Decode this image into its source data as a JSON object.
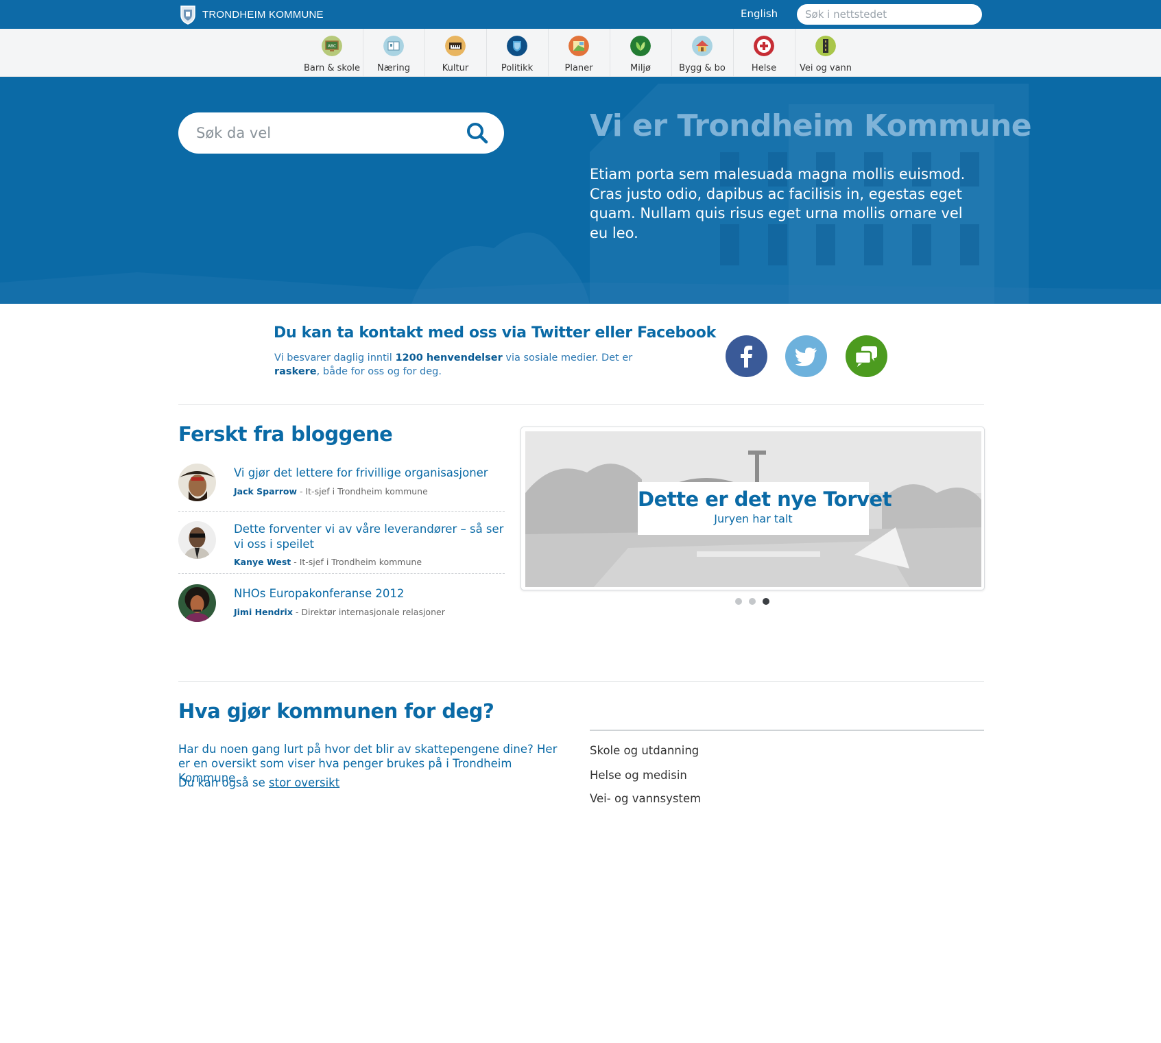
{
  "header": {
    "logo_text": "TRONDHEIM KOMMUNE",
    "english_link": "English",
    "search_placeholder": "Søk i nettstedet"
  },
  "categories": [
    {
      "label": "Barn & skole",
      "icon": "chalkboard-icon",
      "color": "#6b9e3f"
    },
    {
      "label": "Næring",
      "icon": "book-icon",
      "color": "#8fc3d8"
    },
    {
      "label": "Kultur",
      "icon": "piano-icon",
      "color": "#e0a84a"
    },
    {
      "label": "Politikk",
      "icon": "shield-icon",
      "color": "#0e4f86"
    },
    {
      "label": "Planer",
      "icon": "map-icon",
      "color": "#e2733a"
    },
    {
      "label": "Miljø",
      "icon": "leaf-icon",
      "color": "#2f9a3c"
    },
    {
      "label": "Bygg & bo",
      "icon": "house-icon",
      "color": "#d9554b"
    },
    {
      "label": "Helse",
      "icon": "medical-cross-icon",
      "color": "#c62d35"
    },
    {
      "label": "Vei og vann",
      "icon": "road-icon",
      "color": "#8ab644"
    }
  ],
  "hero": {
    "search_placeholder": "Søk da vel",
    "title": "Vi er Trondheim Kommune",
    "text": "Etiam porta sem malesuada magna mollis euismod. Cras justo odio, dapibus ac facilisis in, egestas eget quam. Nullam quis risus eget urna mollis ornare vel eu leo."
  },
  "social": {
    "title": "Du kan ta kontakt med oss via Twitter eller Facebook",
    "text_before": "Vi besvarer daglig inntil ",
    "text_bold1": "1200 henvendelser",
    "text_middle": " via sosiale medier. Det er ",
    "text_bold2": "raskere",
    "text_after": ", både for oss og for deg.",
    "colors": {
      "facebook": "#3a5a98",
      "twitter": "#6db1dc",
      "chat": "#4c9b1f"
    }
  },
  "blogs": {
    "heading": "Ferskt fra bloggene",
    "posts": [
      {
        "title": "Vi gjør det lettere for frivillige organisasjoner",
        "author": "Jack Sparrow",
        "role": " - It-sjef i Trondheim kommune"
      },
      {
        "title": "Dette forventer vi av våre leverandører – så ser vi oss i speilet",
        "author": "Kanye West",
        "role": " - It-sjef i Trondheim kommune"
      },
      {
        "title": "NHOs Europakonferanse 2012",
        "author": "Jimi Hendrix",
        "role": " - Direktør internasjonale relasjoner"
      }
    ]
  },
  "slider": {
    "title": "Dette er det nye Torvet",
    "subtitle": "Juryen har talt",
    "active_index": 2,
    "count": 3
  },
  "what": {
    "heading": "Hva gjør kommunen for deg?",
    "paragraph": "Har du noen gang lurt på hvor det blir av skattepengene dine? Her er en oversikt som viser hva penger brukes på i Trondheim Kommune.",
    "link_prefix": "Du kan også se ",
    "link_text": "stor oversikt",
    "items": [
      "Skole og utdanning",
      "Helse og medisin",
      "Vei- og vannsystem"
    ]
  }
}
